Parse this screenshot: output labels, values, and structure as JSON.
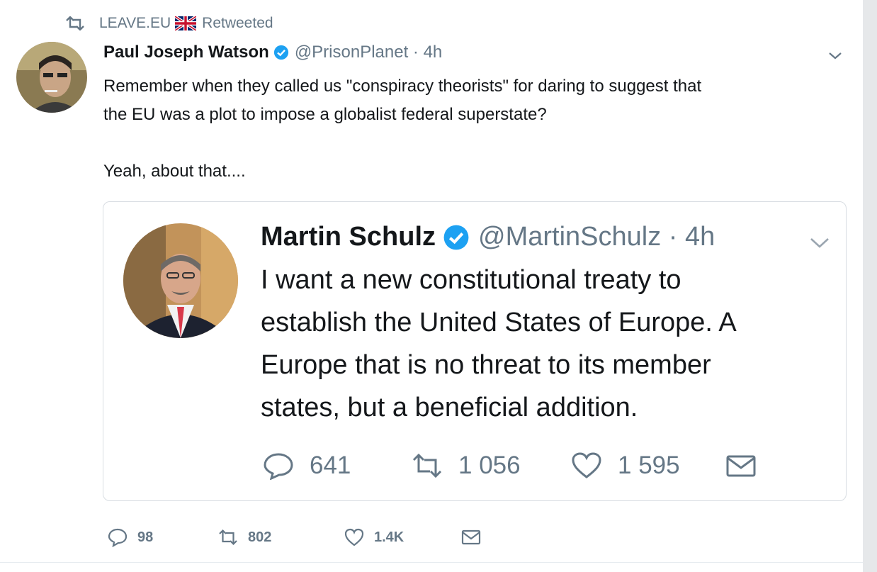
{
  "retweet_bar": {
    "account": "LEAVE.EU",
    "status": "Retweeted"
  },
  "tweet": {
    "author_name": "Paul Joseph Watson",
    "handle_time": "@PrisonPlanet · 4h",
    "text_lines": [
      "Remember when they called us \"conspiracy theorists\" for daring to suggest that",
      "the EU was a plot to impose a globalist federal superstate?",
      "",
      "Yeah, about that...."
    ],
    "actions": {
      "replies": "98",
      "retweets": "802",
      "likes": "1.4K"
    }
  },
  "quoted": {
    "author_name": "Martin Schulz",
    "handle_time": "@MartinSchulz · 4h",
    "text_lines": [
      "I want a new constitutional treaty to",
      "establish the United States of Europe. A",
      "Europe that is no threat to its member",
      "states, but a beneficial addition."
    ],
    "actions": {
      "replies": "641",
      "retweets": "1 056",
      "likes": "1 595"
    }
  },
  "icons": [
    "retweet-icon",
    "uk-flag-icon",
    "verified-badge-icon",
    "chevron-down-icon",
    "reply-icon",
    "like-icon",
    "direct-message-icon"
  ],
  "colors": {
    "text": "#14171a",
    "secondary": "#657786",
    "verified": "#1da1f2",
    "border": "#d8dde2"
  }
}
